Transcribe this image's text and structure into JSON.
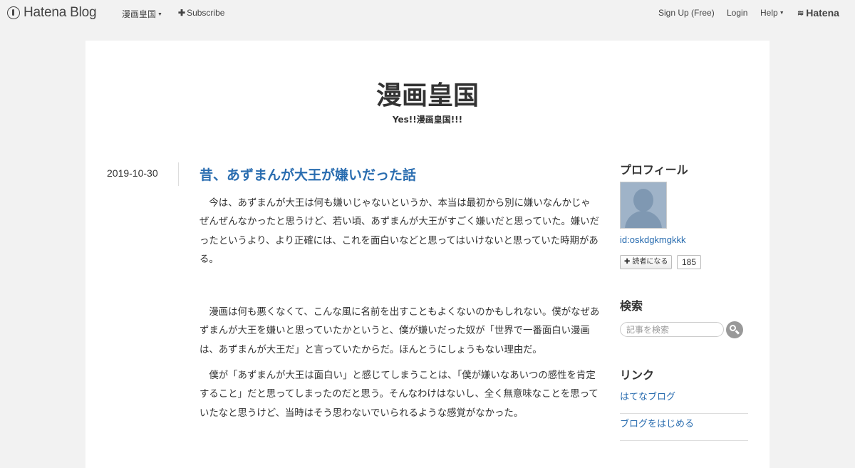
{
  "topbar": {
    "brand": "Hatena Blog",
    "blog_menu": "漫画皇国",
    "subscribe": "Subscribe",
    "signup": "Sign Up (Free)",
    "login": "Login",
    "help": "Help",
    "hatena": "Hatena"
  },
  "blog": {
    "title": "漫画皇国",
    "description": "Yes!!漫画皇国!!!"
  },
  "entry": {
    "date": "2019-10-30",
    "title": "昔、あずまんが大王が嫌いだった話",
    "paragraphs": [
      "今は、あずまんが大王は何も嫌いじゃないというか、本当は最初から別に嫌いなんかじゃぜんぜんなかったと思うけど、若い頃、あずまんが大王がすごく嫌いだと思っていた。嫌いだったというより、より正確には、これを面白いなどと思ってはいけないと思っていた時期がある。",
      "漫画は何も悪くなくて、こんな風に名前を出すこともよくないのかもしれない。僕がなぜあずまんが大王を嫌いと思っていたかというと、僕が嫌いだった奴が「世界で一番面白い漫画は、あずまんが大王だ」と言っていたからだ。ほんとうにしょうもない理由だ。",
      "僕が「あずまんが大王は面白い」と感じてしまうことは、「僕が嫌いなあいつの感性を肯定すること」だと思ってしまったのだと思う。そんなわけはないし、全く無意味なことを思っていたなと思うけど、当時はそう思わないでいられるような感覚がなかった。"
    ]
  },
  "sidebar": {
    "profile_heading": "プロフィール",
    "profile_id": "id:oskdgkmgkkk",
    "follow_label": "読者になる",
    "follow_count": "185",
    "search_heading": "検索",
    "search_placeholder": "記事を検索",
    "links_heading": "リンク",
    "links": [
      "はてなブログ",
      "ブログをはじめる"
    ]
  }
}
